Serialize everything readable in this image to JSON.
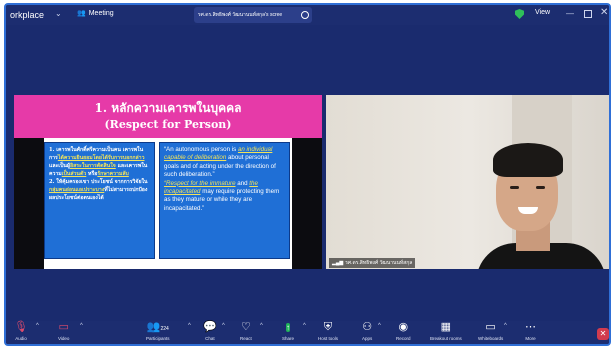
{
  "titlebar": {
    "app_name": "orkplace",
    "meeting_label": "Meeting",
    "tab_title": "รศ.ดร.สิทธิพงศ์ วัฒนานนท์สกุล's scree",
    "view_label": "View",
    "colors": {
      "bar": "#1c2d70",
      "shield": "#2fbf5a"
    }
  },
  "slide": {
    "title_line1": "1. หลักความเคารพในบุคคล",
    "title_line2": "(Respect for Person)",
    "left_text_a": "1. เคารพในศักดิ์ศรีความเป็นคน เคารพในการ",
    "left_hl_a": "ได้ความยินยอมโดยได้รับการบอกกล่าว",
    "left_text_b": " และเป็นผู้",
    "left_hl_b": "อิสระในการตัดสินใจ",
    "left_text_c": " และเคารพในความ",
    "left_hl_c": "เป็นส่วนตัว",
    "left_text_d": " หรือ",
    "left_hl_d": "รักษาความลับ",
    "left_text_e": "2. ให้คุ้มครองเขา ประโยชน์ จากการวิจัยใน",
    "left_hl_e": "กลุ่มคนอ่อนแอเปราะบาง",
    "left_text_f": "ที่ไม่สามารถปกป้องผลประโยชน์ต่อตนเองได้",
    "right_p1": "“An autonomous person is ",
    "right_p1_hl": "an individual capable of deliberation",
    "right_p1b": " about personal goals and of acting under the direction of such deliberation.”",
    "right_p2_hl1": "“Respect for the immature",
    "right_p2_and": " and ",
    "right_p2_hl2": "the incapacitated",
    "right_p2b": " may require protecting them as they mature or while they are incapacitated.”",
    "colors": {
      "header": "#e63aa8",
      "panel": "#1f6fd6",
      "highlight": "#f2e35a"
    }
  },
  "video": {
    "participant_name": "รศ.ดร.สิทธิพงศ์ วัฒนานนท์สกุล"
  },
  "toolbar": {
    "audio_label": "Audio",
    "video_label": "Video",
    "participants_label": "Participants",
    "participants_count": "224",
    "chat_label": "Chat",
    "react_label": "React",
    "share_label": "Share",
    "host_tools_label": "Host tools",
    "apps_label": "Apps",
    "record_label": "Record",
    "breakout_label": "Breakout rooms",
    "whiteboards_label": "Whiteboards",
    "more_label": "More",
    "colors": {
      "share": "#1fb25a",
      "end": "#d23b4e",
      "mic_muted": "#e04b6b"
    }
  }
}
